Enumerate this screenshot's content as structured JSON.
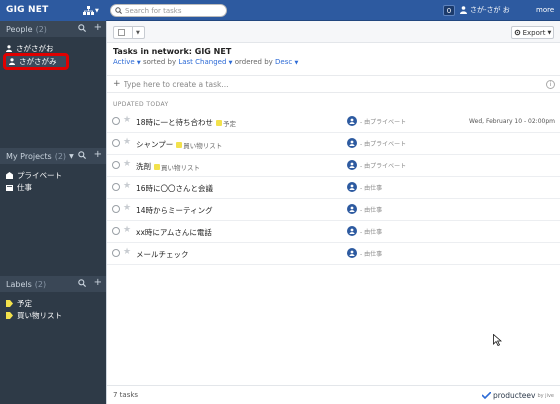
{
  "topbar": {
    "brand": "GIG NET",
    "search_placeholder": "Search for tasks",
    "notifications": "0",
    "user_name": "さが-さが お",
    "more": "more"
  },
  "sidebar": {
    "people": {
      "title": "People",
      "count": "(2)",
      "items": [
        {
          "label": "さがさがお"
        },
        {
          "label": "さがさがみ"
        }
      ]
    },
    "projects": {
      "title": "My Projects",
      "count": "(2)",
      "items": [
        {
          "label": "プライベート"
        },
        {
          "label": "仕事"
        }
      ]
    },
    "labels": {
      "title": "Labels",
      "count": "(2)",
      "items": [
        {
          "label": "予定",
          "color": "#f2e14c"
        },
        {
          "label": "買い物リスト",
          "color": "#f2e14c"
        }
      ]
    }
  },
  "toolbar": {
    "export_label": "Export"
  },
  "main": {
    "title": "Tasks in network: GIG NET",
    "filter_status": "Active",
    "filter_sorted_by": "sorted by",
    "filter_sort_field": "Last Changed",
    "filter_ordered_by": "ordered by",
    "filter_order": "Desc",
    "create_placeholder": "Type here to create a task...",
    "section_label": "UPDATED TODAY",
    "tasks": [
      {
        "title": "18時に一と待ち合わせ",
        "tag": "予定",
        "tag_color": "#f2e14c",
        "assignee": "- 由プライベート",
        "due": "Wed, February 10 - 02:00pm"
      },
      {
        "title": "シャンプー",
        "tag": "買い物リスト",
        "tag_color": "#f2e14c",
        "assignee": "- 由プライベート",
        "due": ""
      },
      {
        "title": "洗剤",
        "tag": "買い物リスト",
        "tag_color": "#f2e14c",
        "assignee": "- 由プライベート",
        "due": ""
      },
      {
        "title": "16時に〇〇さんと会議",
        "tag": "",
        "tag_color": "",
        "assignee": "- 由仕事",
        "due": ""
      },
      {
        "title": "14時からミーティング",
        "tag": "",
        "tag_color": "",
        "assignee": "- 由仕事",
        "due": ""
      },
      {
        "title": "xx時にアムさんに電話",
        "tag": "",
        "tag_color": "",
        "assignee": "- 由仕事",
        "due": ""
      },
      {
        "title": "メールチェック",
        "tag": "",
        "tag_color": "",
        "assignee": "- 由仕事",
        "due": ""
      }
    ]
  },
  "footer": {
    "task_count": "7 tasks",
    "brand": "producteev",
    "brand_suffix": "by jive"
  },
  "colors": {
    "topbar": "#2d5aa0",
    "sidebar": "#2e3a47",
    "highlight": "#e00000",
    "link": "#2d6bd6"
  }
}
